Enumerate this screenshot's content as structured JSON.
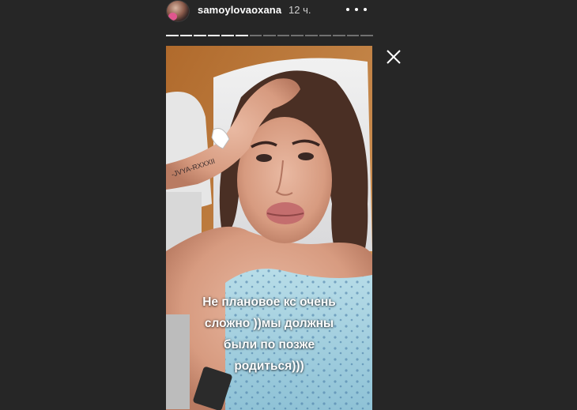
{
  "story": {
    "username": "samoylovaoxana",
    "timestamp": "12 ч.",
    "progress": {
      "total_segments": 15,
      "completed_segments": 6
    },
    "caption_lines": [
      "Не плановое кс очень",
      "сложно ))мы должны",
      "были по позже",
      "родиться)))"
    ],
    "icons": {
      "more": "more-horizontal-icon",
      "close": "close-icon"
    }
  },
  "colors": {
    "background": "#262626",
    "text": "#ffffff",
    "muted_text": "#d0d0d0"
  }
}
